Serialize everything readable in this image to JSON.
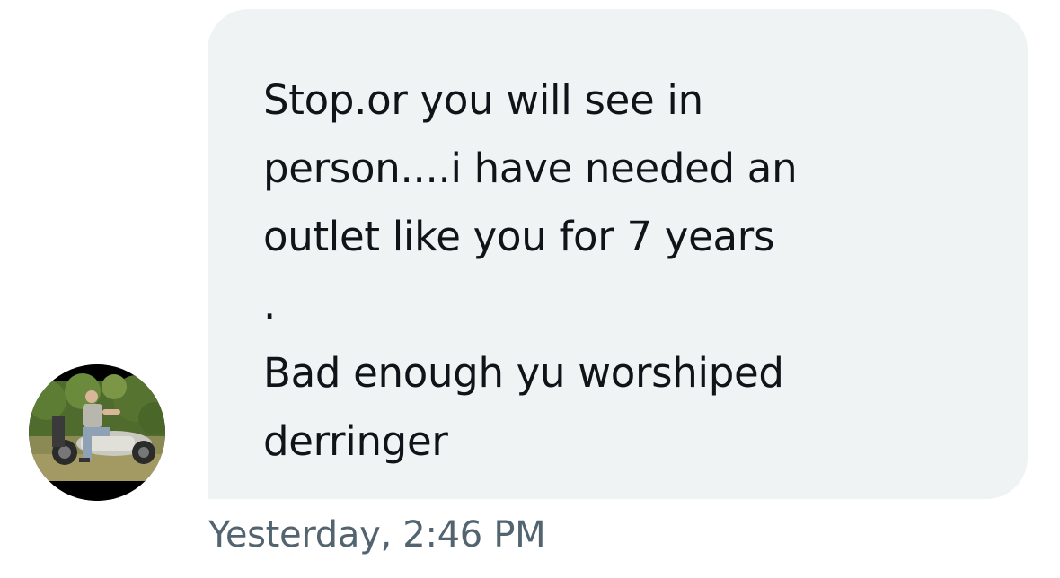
{
  "message": {
    "text": "Stop.or you will see in\nperson....i have needed an\noutlet like you for 7 years\n.\nBad enough yu worshiped\nderringer",
    "timestamp": "Yesterday, 2:46 PM"
  },
  "sender": {
    "avatar_icon": "avatar-photo-motorcycle"
  },
  "colors": {
    "bubble_bg": "#eff3f4",
    "text": "#0f1419",
    "timestamp": "#536471"
  }
}
